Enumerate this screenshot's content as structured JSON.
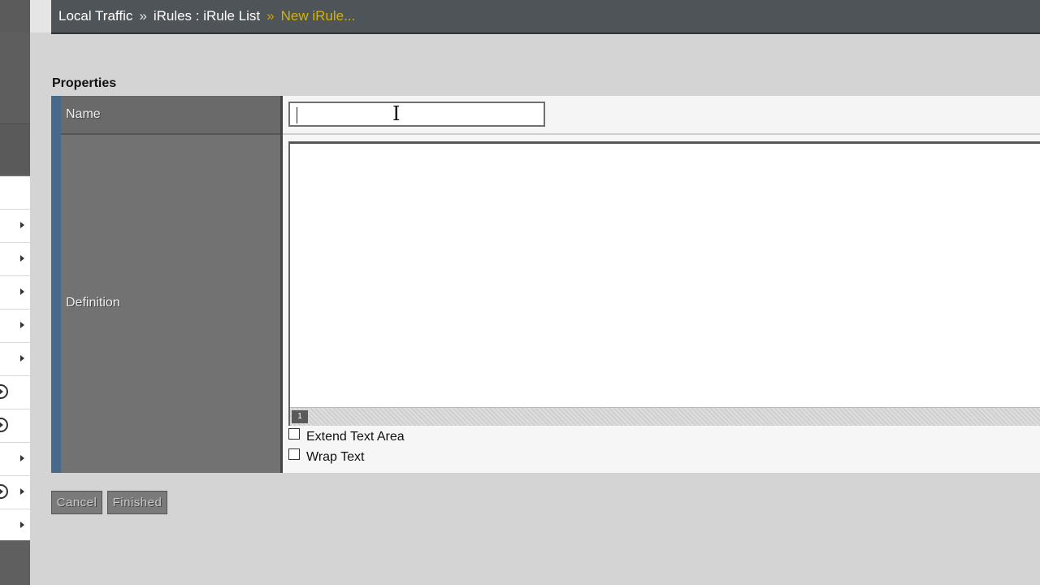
{
  "breadcrumb": {
    "item1": "Local Traffic",
    "sep1": "»",
    "item2": "iRules : iRule List",
    "sep2": "»",
    "current": "New iRule..."
  },
  "section": {
    "title": "Properties"
  },
  "form": {
    "name_label": "Name",
    "name_value": "",
    "definition_label": "Definition",
    "definition_value": "",
    "line_number": "1",
    "extend_text_area_label": "Extend Text Area",
    "wrap_text_label": "Wrap Text"
  },
  "buttons": {
    "cancel": "Cancel",
    "finished": "Finished"
  },
  "colors": {
    "header_bg": "#4f5459",
    "current_crumb": "#d4b400",
    "label_col": "#6e6e6e",
    "rail": "#486a8a"
  }
}
